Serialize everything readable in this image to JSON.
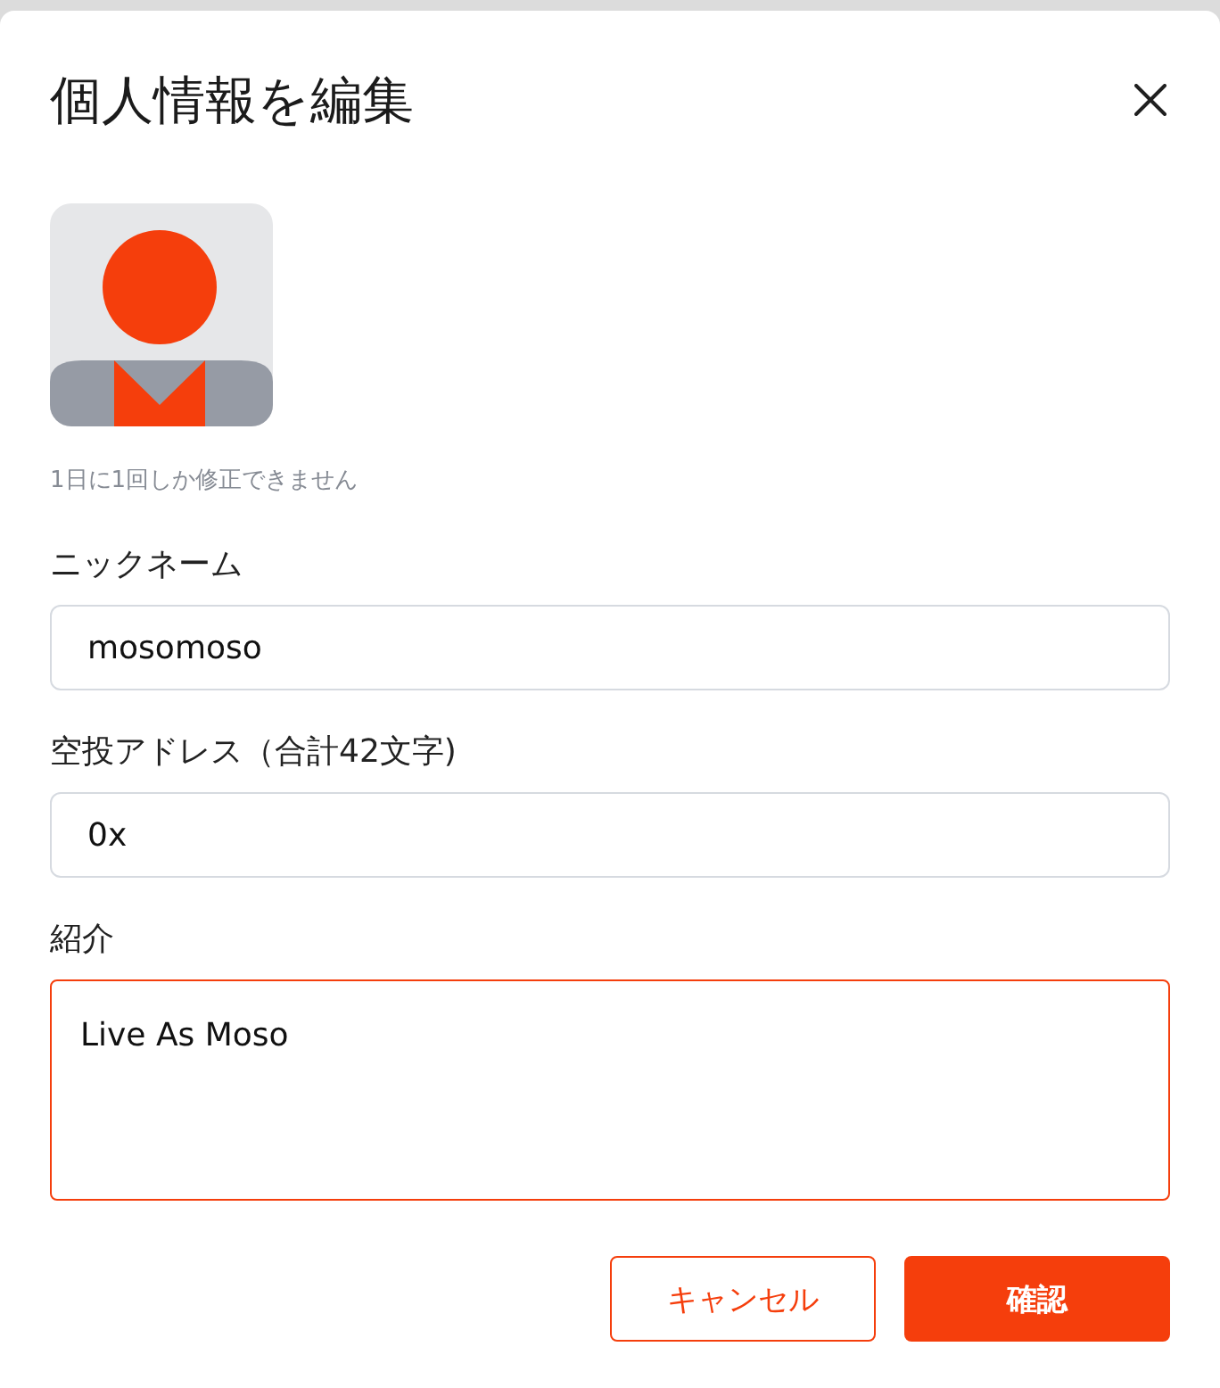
{
  "dialog": {
    "title": "個人情報を編集"
  },
  "avatar_hint": "1日に1回しか修正できません",
  "fields": [
    {
      "kind": "input",
      "label": "ニックネーム",
      "value": "mosomoso",
      "focused": false
    },
    {
      "kind": "input",
      "label": "空投アドレス（合計42文字)",
      "value": "0x",
      "focused": false
    },
    {
      "kind": "textarea",
      "label": "紹介",
      "value": "Live As Moso",
      "focused": true
    }
  ],
  "buttons": [
    {
      "kind": "secondary",
      "label": "キャンセル"
    },
    {
      "kind": "primary",
      "label": "確認"
    }
  ]
}
